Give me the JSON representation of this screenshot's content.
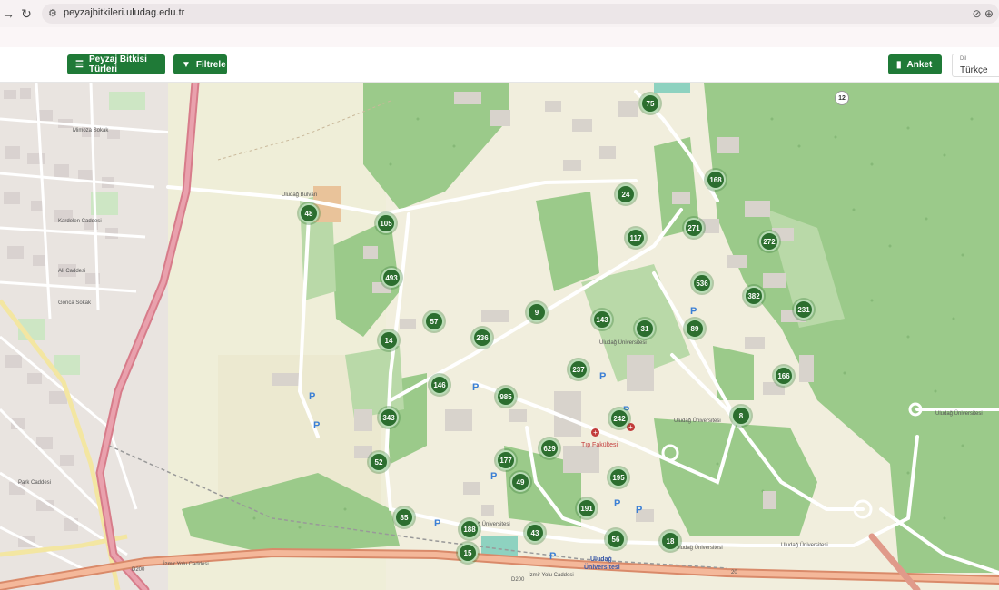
{
  "browser": {
    "back_icon": "arrow-right-icon",
    "reload_icon": "reload-icon",
    "url": "peyzajbitkileri.uludag.edu.tr"
  },
  "toolbar": {
    "species_button": "Peyzaj Bitkisi Türleri",
    "filter_button": "Filtrele",
    "survey_button": "Anket",
    "language_caption": "Dil",
    "language_value": "Türkçe",
    "accent_color": "#1f7a37"
  },
  "map": {
    "clusters": [
      {
        "id": "c75",
        "label": "75"
      },
      {
        "id": "c12",
        "label": "12"
      },
      {
        "id": "c168",
        "label": "168"
      },
      {
        "id": "c24",
        "label": "24"
      },
      {
        "id": "c48",
        "label": "48"
      },
      {
        "id": "c105",
        "label": "105"
      },
      {
        "id": "c271",
        "label": "271"
      },
      {
        "id": "c117",
        "label": "117"
      },
      {
        "id": "c272",
        "label": "272"
      },
      {
        "id": "c493",
        "label": "493"
      },
      {
        "id": "c536",
        "label": "536"
      },
      {
        "id": "c382",
        "label": "382"
      },
      {
        "id": "c9",
        "label": "9"
      },
      {
        "id": "c143",
        "label": "143"
      },
      {
        "id": "c231",
        "label": "231"
      },
      {
        "id": "c57",
        "label": "57"
      },
      {
        "id": "c31",
        "label": "31"
      },
      {
        "id": "c89",
        "label": "89"
      },
      {
        "id": "c14",
        "label": "14"
      },
      {
        "id": "c236",
        "label": "236"
      },
      {
        "id": "c237",
        "label": "237"
      },
      {
        "id": "c166",
        "label": "166"
      },
      {
        "id": "c146",
        "label": "146"
      },
      {
        "id": "c985",
        "label": "985"
      },
      {
        "id": "c343",
        "label": "343"
      },
      {
        "id": "c242",
        "label": "242"
      },
      {
        "id": "c8",
        "label": "8"
      },
      {
        "id": "c629",
        "label": "629"
      },
      {
        "id": "c177",
        "label": "177"
      },
      {
        "id": "c52",
        "label": "52"
      },
      {
        "id": "c49",
        "label": "49"
      },
      {
        "id": "c195",
        "label": "195"
      },
      {
        "id": "c85",
        "label": "85"
      },
      {
        "id": "c191",
        "label": "191"
      },
      {
        "id": "c188",
        "label": "188"
      },
      {
        "id": "c43",
        "label": "43"
      },
      {
        "id": "c56",
        "label": "56"
      },
      {
        "id": "c18",
        "label": "18"
      },
      {
        "id": "c15",
        "label": "15"
      }
    ],
    "labels": {
      "tip_fakultesi": "Tıp Fakültesi",
      "uludag_universitesi_1": "Uludağ",
      "uludag_universitesi_2": "Üniversitesi",
      "izmir_yolu_1": "İzmir Yolu Caddesi",
      "izmir_yolu_2": "İzmir Yolu Caddesi",
      "d200_1": "D200",
      "d200_2": "D200",
      "park_caddesi": "Park Caddesi",
      "uludag_univ_road_1": "Uludağ Üniversitesi",
      "uludag_univ_road_2": "Uludağ Üniversitesi",
      "uludag_univ_road_3": "Uludağ Üniversitesi",
      "uludag_univ_road_4": "Uludağ Üniversitesi",
      "uludag_univ_road_5": "Uludağ Üniversitesi",
      "uludag_univ_road_6": "Uludağ Üniversitesi",
      "bulvar": "Uludağ Bulvarı",
      "ali_caddesi": "Ali Caddesi",
      "mimoza": "Mimoza Sokak",
      "gonca": "Gonca Sokak",
      "kardelen": "Kardelen Caddesi",
      "route_num": "20"
    }
  }
}
